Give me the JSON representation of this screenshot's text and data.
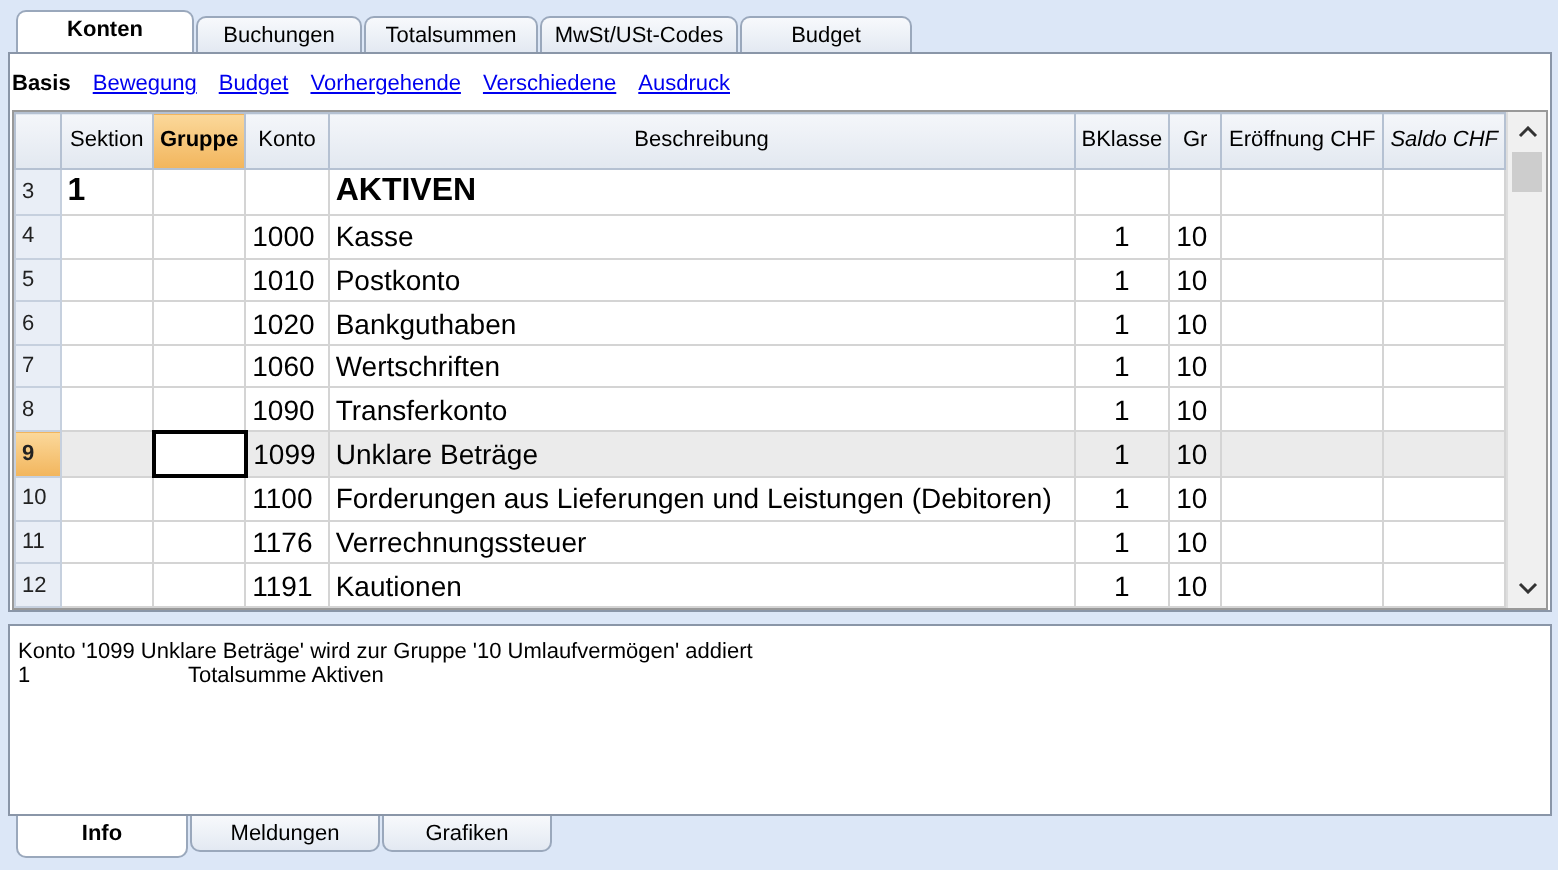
{
  "tabs": [
    {
      "label": "Konten",
      "selected": true
    },
    {
      "label": "Buchungen",
      "selected": false
    },
    {
      "label": "Totalsummen",
      "selected": false
    },
    {
      "label": "MwSt/USt-Codes",
      "selected": false
    },
    {
      "label": "Budget",
      "selected": false
    }
  ],
  "views": [
    {
      "label": "Basis",
      "selected": true
    },
    {
      "label": "Bewegung",
      "selected": false
    },
    {
      "label": "Budget",
      "selected": false
    },
    {
      "label": "Vorhergehende",
      "selected": false
    },
    {
      "label": "Verschiedene",
      "selected": false
    },
    {
      "label": "Ausdruck",
      "selected": false
    }
  ],
  "table": {
    "columns": [
      {
        "label": "Sektion",
        "selected": false,
        "italic": false
      },
      {
        "label": "Gruppe",
        "selected": true,
        "italic": false
      },
      {
        "label": "Konto",
        "selected": false,
        "italic": false
      },
      {
        "label": "Beschreibung",
        "selected": false,
        "italic": false
      },
      {
        "label": "BKlasse",
        "selected": false,
        "italic": false
      },
      {
        "label": "Gr",
        "selected": false,
        "italic": false
      },
      {
        "label": "Eröffnung CHF",
        "selected": false,
        "italic": false
      },
      {
        "label": "Saldo CHF",
        "selected": false,
        "italic": true
      }
    ],
    "rows": [
      {
        "number": "3",
        "kind": "heading",
        "selected": false,
        "cells": [
          "1",
          "",
          "",
          "AKTIVEN",
          "",
          "",
          "",
          ""
        ]
      },
      {
        "number": "4",
        "kind": "account",
        "selected": false,
        "cells": [
          "",
          "",
          "1000",
          "Kasse",
          "1",
          "10",
          "",
          ""
        ]
      },
      {
        "number": "5",
        "kind": "account",
        "selected": false,
        "cells": [
          "",
          "",
          "1010",
          "Postkonto",
          "1",
          "10",
          "",
          ""
        ]
      },
      {
        "number": "6",
        "kind": "account",
        "selected": false,
        "cells": [
          "",
          "",
          "1020",
          "Bankguthaben",
          "1",
          "10",
          "",
          ""
        ]
      },
      {
        "number": "7",
        "kind": "account",
        "selected": false,
        "cells": [
          "",
          "",
          "1060",
          "Wertschriften",
          "1",
          "10",
          "",
          ""
        ]
      },
      {
        "number": "8",
        "kind": "account",
        "selected": false,
        "cells": [
          "",
          "",
          "1090",
          "Transferkonto",
          "1",
          "10",
          "",
          ""
        ]
      },
      {
        "number": "9",
        "kind": "account",
        "selected": true,
        "cells": [
          "",
          "",
          "1099",
          "Unklare Beträge",
          "1",
          "10",
          "",
          ""
        ]
      },
      {
        "number": "10",
        "kind": "account",
        "selected": false,
        "cells": [
          "",
          "",
          "1100",
          "Forderungen aus Lieferungen und Leistungen (Debitoren)",
          "1",
          "10",
          "",
          ""
        ]
      },
      {
        "number": "11",
        "kind": "account",
        "selected": false,
        "cells": [
          "",
          "",
          "1176",
          "Verrechnungssteuer",
          "1",
          "10",
          "",
          ""
        ]
      },
      {
        "number": "12",
        "kind": "account",
        "selected": false,
        "cells": [
          "",
          "",
          "1191",
          "Kautionen",
          "1",
          "10",
          "",
          ""
        ]
      }
    ]
  },
  "info": {
    "message": "Konto '1099 Unklare Beträge' wird zur Gruppe '10 Umlaufvermögen' addiert",
    "lines": [
      {
        "code": "1",
        "text": "Totalsumme Aktiven"
      }
    ]
  },
  "bottom_tabs": [
    {
      "label": "Info",
      "selected": true
    },
    {
      "label": "Meldungen",
      "selected": false
    },
    {
      "label": "Grafiken",
      "selected": false
    }
  ]
}
